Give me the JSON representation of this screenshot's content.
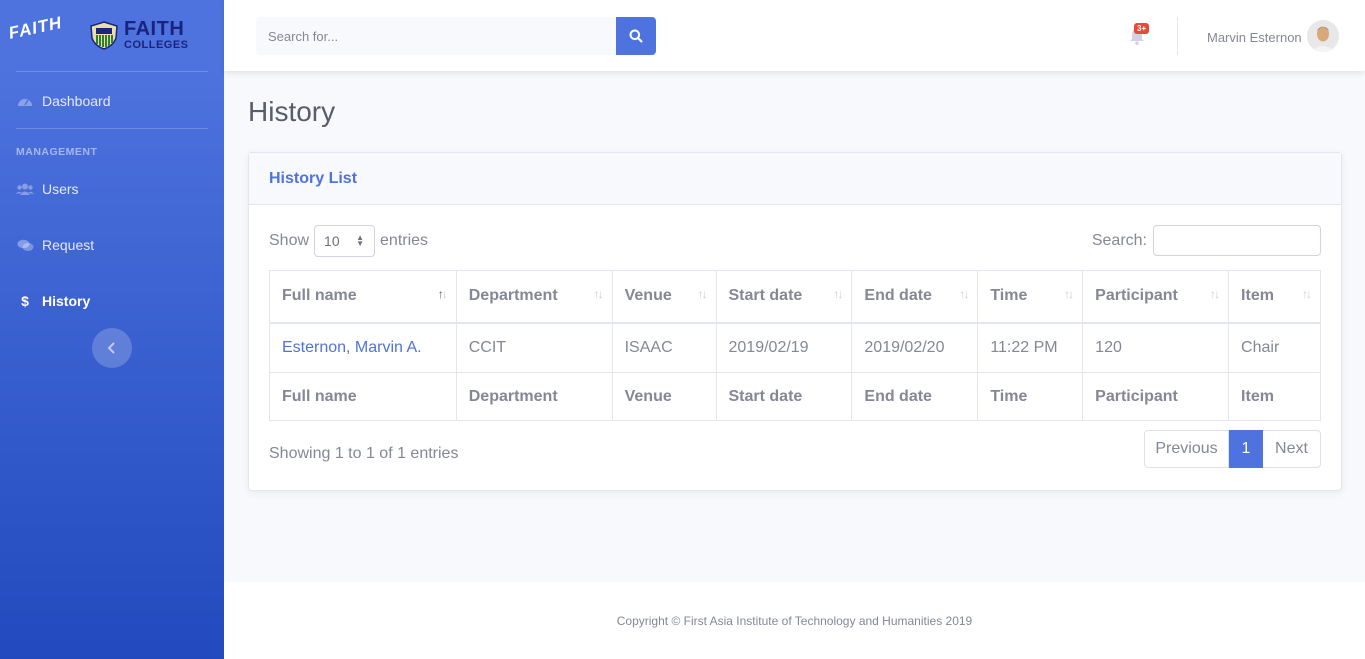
{
  "sidebar": {
    "brand_word": "FAITH",
    "logo_title": "FAITH",
    "logo_subtitle": "COLLEGES",
    "items": [
      {
        "label": "Dashboard",
        "icon": "tachometer-icon"
      },
      {
        "label": "Users",
        "icon": "users-icon"
      },
      {
        "label": "Request",
        "icon": "comments-icon"
      },
      {
        "label": "History",
        "icon": "dollar-icon",
        "active": true
      }
    ],
    "heading": "MANAGEMENT"
  },
  "topbar": {
    "search_placeholder": "Search for...",
    "notification_badge": "3+",
    "user_name": "Marvin Esternon"
  },
  "page": {
    "title": "History"
  },
  "card": {
    "title": "History List",
    "show_label": "Show",
    "page_length": "10",
    "entries_label": "entries",
    "search_label": "Search:",
    "columns": [
      "Full name",
      "Department",
      "Venue",
      "Start date",
      "End date",
      "Time",
      "Participant",
      "Item"
    ],
    "rows": [
      [
        "Esternon, Marvin A.",
        "CCIT",
        "ISAAC",
        "2019/02/19",
        "2019/02/20",
        "11:22 PM",
        "120",
        "Chair"
      ]
    ],
    "info": "Showing 1 to 1 of 1 entries",
    "pagination": {
      "previous": "Previous",
      "current": "1",
      "next": "Next"
    }
  },
  "footer": {
    "copyright": "Copyright © First Asia Institute of Technology and Humanities 2019"
  },
  "colors": {
    "primary": "#4e73df",
    "sidebar_gradient_end": "#224abe",
    "danger": "#e74a3b",
    "text": "#858796"
  }
}
